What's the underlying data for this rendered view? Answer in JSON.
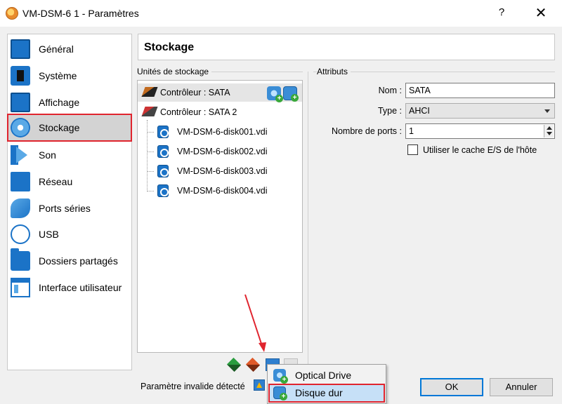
{
  "window": {
    "title": "VM-DSM-6 1 - Paramètres",
    "help_label": "?",
    "close_label": "✕"
  },
  "sidebar": {
    "items": [
      {
        "label": "Général",
        "icon": "monitor-icon"
      },
      {
        "label": "Système",
        "icon": "chip-icon"
      },
      {
        "label": "Affichage",
        "icon": "display-icon"
      },
      {
        "label": "Stockage",
        "icon": "storage-disc-icon",
        "selected": true
      },
      {
        "label": "Son",
        "icon": "speaker-icon"
      },
      {
        "label": "Réseau",
        "icon": "network-icon"
      },
      {
        "label": "Ports séries",
        "icon": "serial-port-icon"
      },
      {
        "label": "USB",
        "icon": "usb-icon"
      },
      {
        "label": "Dossiers partagés",
        "icon": "folder-icon"
      },
      {
        "label": "Interface utilisateur",
        "icon": "user-interface-icon"
      }
    ]
  },
  "header": {
    "title": "Stockage"
  },
  "storage": {
    "group_label": "Unités de stockage",
    "tree": {
      "controller1": "Contrôleur : SATA",
      "controller2": "Contrôleur : SATA 2",
      "disks": [
        "VM-DSM-6-disk001.vdi",
        "VM-DSM-6-disk002.vdi",
        "VM-DSM-6-disk003.vdi",
        "VM-DSM-6-disk004.vdi"
      ]
    }
  },
  "attributes": {
    "group_label": "Attributs",
    "name_label": "Nom :",
    "name_value": "SATA",
    "type_label": "Type :",
    "type_value": "AHCI",
    "ports_label": "Nombre de ports :",
    "ports_value": "1",
    "cache_label": "Utiliser le cache E/S de l'hôte",
    "cache_checked": false
  },
  "menu": {
    "items": [
      {
        "label": "Optical Drive",
        "icon": "optical-drive-icon"
      },
      {
        "label": "Disque dur",
        "icon": "hard-disk-icon",
        "highlighted": true
      }
    ]
  },
  "footer": {
    "invalid_label": "Paramètre invalide détecté",
    "ok_label": "OK",
    "cancel_label": "Annuler"
  },
  "colors": {
    "accent": "#1b73c7",
    "highlight_border": "#e0242e",
    "selection": "#d3d3d3",
    "menu_highlight": "#c6e0f7"
  }
}
